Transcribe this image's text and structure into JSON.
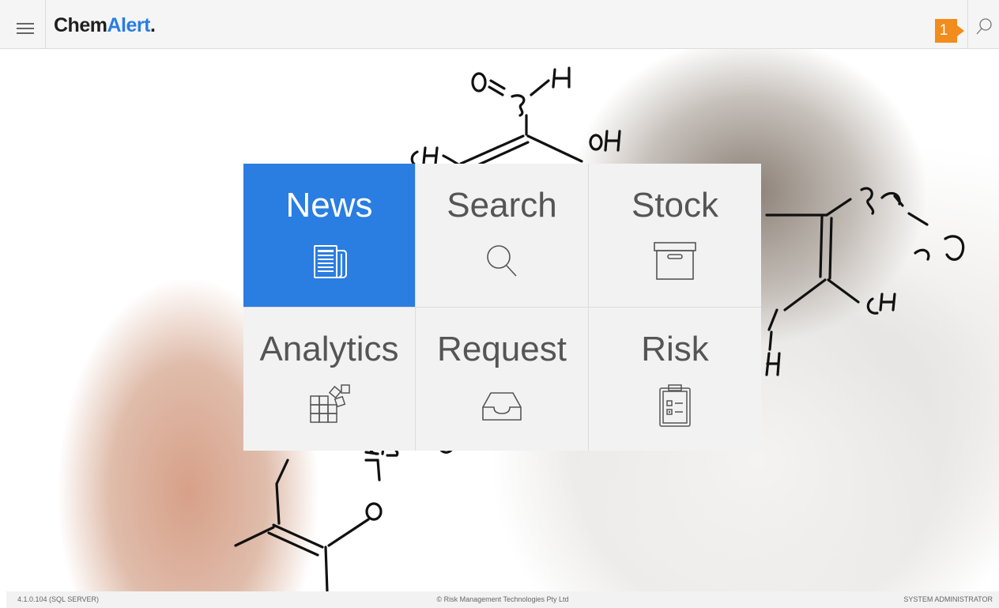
{
  "header": {
    "logo": {
      "part1": "Chem",
      "part2": "Alert",
      "part3": "."
    },
    "notification_count": "1"
  },
  "tiles": [
    {
      "label": "News",
      "icon": "newspaper-icon",
      "active": true
    },
    {
      "label": "Search",
      "icon": "magnifier-icon",
      "active": false
    },
    {
      "label": "Stock",
      "icon": "archive-box-icon",
      "active": false
    },
    {
      "label": "Analytics",
      "icon": "blocks-analytics-icon",
      "active": false
    },
    {
      "label": "Request",
      "icon": "inbox-tray-icon",
      "active": false
    },
    {
      "label": "Risk",
      "icon": "clipboard-checklist-icon",
      "active": false
    }
  ],
  "footer": {
    "version": "4.1.0.104 (SQL SERVER)",
    "copyright": "© Risk Management Technologies Pty Ltd",
    "user": "SYSTEM ADMINISTRATOR"
  },
  "colors": {
    "accent": "#2a7de1",
    "badge": "#f28c1d",
    "tile_bg": "#f2f2f2"
  }
}
